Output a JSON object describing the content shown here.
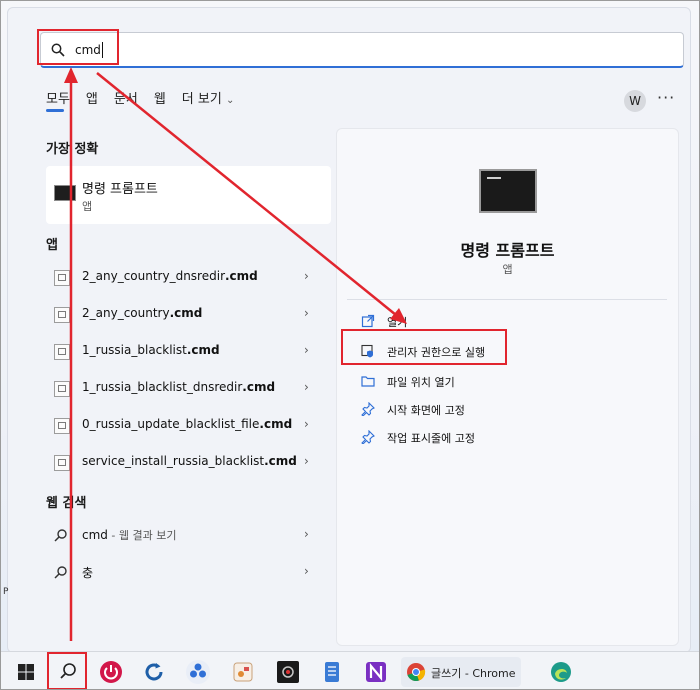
{
  "search": {
    "query": "cmd"
  },
  "tabs": [
    {
      "label": "모두"
    },
    {
      "label": "앱"
    },
    {
      "label": "문서"
    },
    {
      "label": "웹"
    },
    {
      "label": "더 보기"
    }
  ],
  "avatar_letter": "W",
  "more_label": "···",
  "best_match": {
    "section": "가장 정확",
    "title": "명령 프롬프트",
    "subtitle": "앱"
  },
  "apps": {
    "section": "앱",
    "items": [
      {
        "prefix": "2_any_country_dnsredir",
        "ext": ".cmd"
      },
      {
        "prefix": "2_any_country",
        "ext": ".cmd"
      },
      {
        "prefix": "1_russia_blacklist",
        "ext": ".cmd"
      },
      {
        "prefix": "1_russia_blacklist_dnsredir",
        "ext": ".cmd"
      },
      {
        "prefix": "0_russia_update_blacklist_file",
        "ext": ".cmd"
      },
      {
        "prefix": "service_install_russia_blacklist",
        "ext": ".cmd"
      }
    ]
  },
  "web": {
    "section": "웹 검색",
    "items": [
      {
        "term": "cmd",
        "suffix": " - 웹 결과 보기"
      },
      {
        "term": "충",
        "suffix": ""
      }
    ]
  },
  "detail": {
    "title": "명령 프롬프트",
    "subtitle": "앱",
    "actions": [
      {
        "label": "열기"
      },
      {
        "label": "관리자 권한으로 실행"
      },
      {
        "label": "파일 위치 열기"
      },
      {
        "label": "시작 화면에 고정"
      },
      {
        "label": "작업 표시줄에 고정"
      }
    ]
  },
  "taskbar": {
    "chrome_label": "글쓰기 - Chrome"
  },
  "edge_letter": "P",
  "colors": {
    "accent": "#2f6fd6",
    "annotation": "#e1252e",
    "power": "#d2174a",
    "notion": "#7a2fc2"
  }
}
